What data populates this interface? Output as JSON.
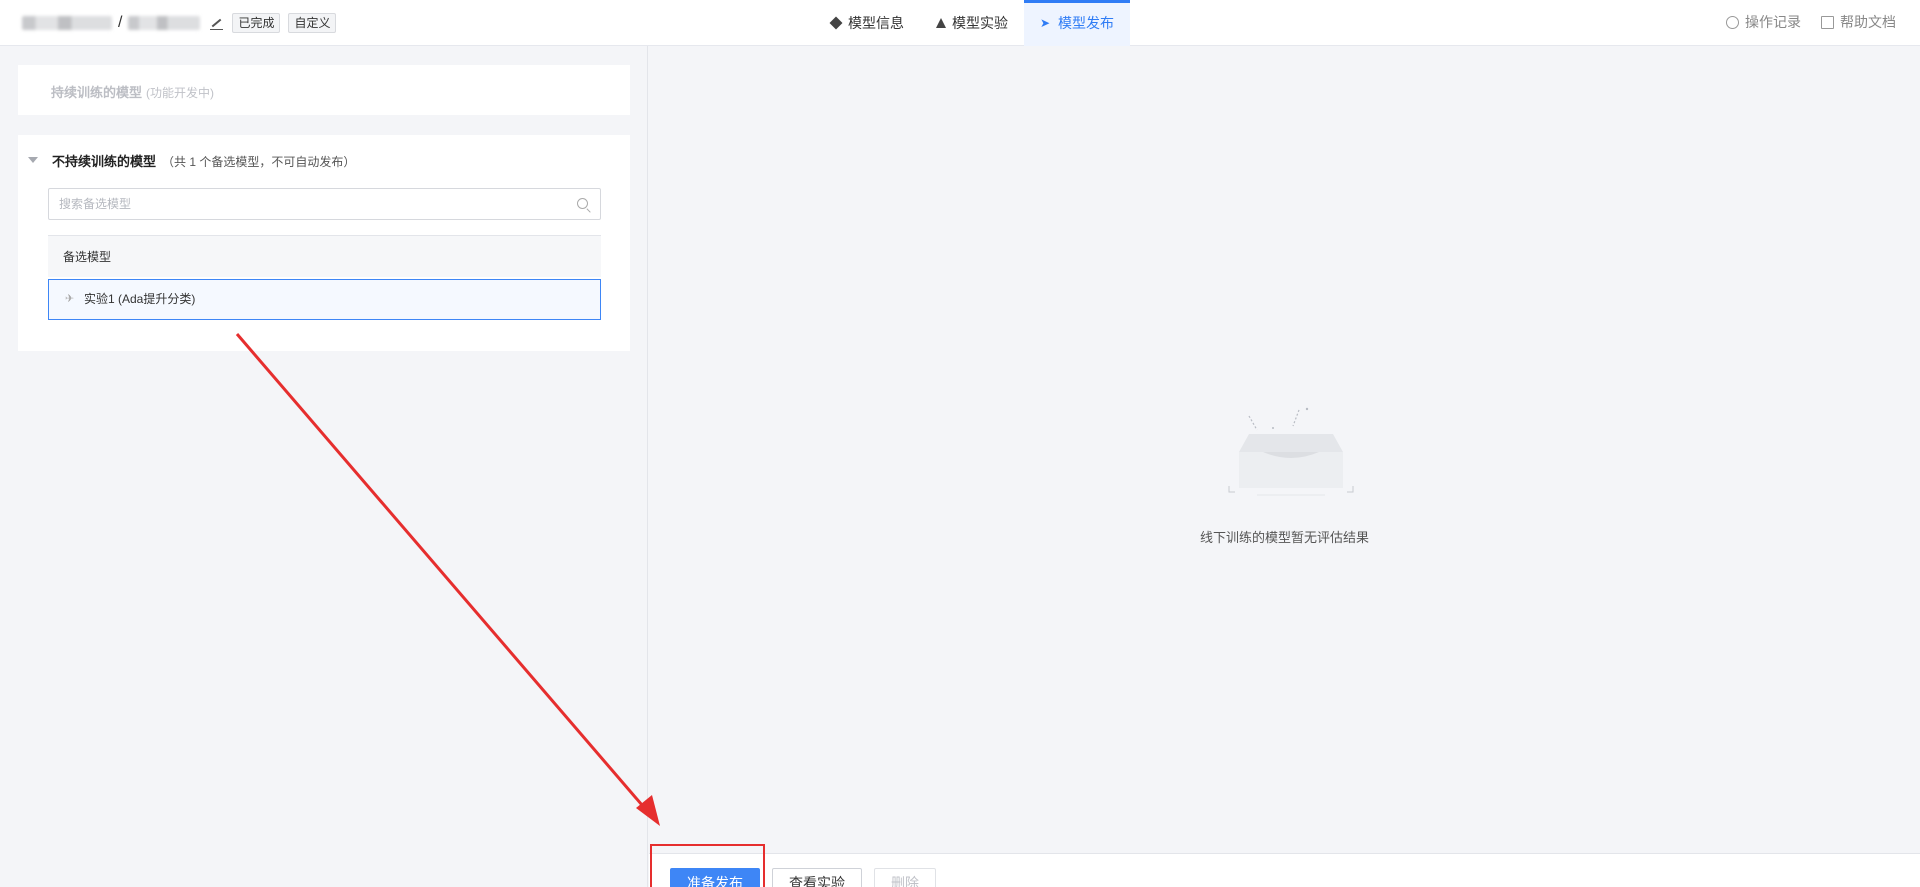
{
  "header": {
    "separator": "/",
    "tags": [
      "已完成",
      "自定义"
    ],
    "tabs": [
      {
        "label": "模型信息",
        "icon": "cube-icon",
        "active": false
      },
      {
        "label": "模型实验",
        "icon": "flask-icon",
        "active": false
      },
      {
        "label": "模型发布",
        "icon": "send-icon",
        "active": true
      }
    ],
    "links": [
      {
        "label": "操作记录",
        "icon": "history-icon"
      },
      {
        "label": "帮助文档",
        "icon": "external-link-icon"
      }
    ]
  },
  "left": {
    "continuous": {
      "title": "持续训练的模型",
      "subtitle": "(功能开发中)"
    },
    "non_continuous": {
      "title": "不持续训练的模型",
      "subtitle": "（共 1 个备选模型，不可自动发布）",
      "search_placeholder": "搜索备选模型",
      "list_header": "备选模型",
      "items": [
        {
          "label": "实验1 (Ada提升分类)"
        }
      ]
    }
  },
  "right": {
    "empty_text": "线下训练的模型暂无评估结果"
  },
  "footer": {
    "prepare_publish": "准备发布",
    "view_experiment": "查看实验",
    "delete": "删除"
  },
  "colors": {
    "accent": "#2f7cf5",
    "annotation": "#e62e2e"
  }
}
